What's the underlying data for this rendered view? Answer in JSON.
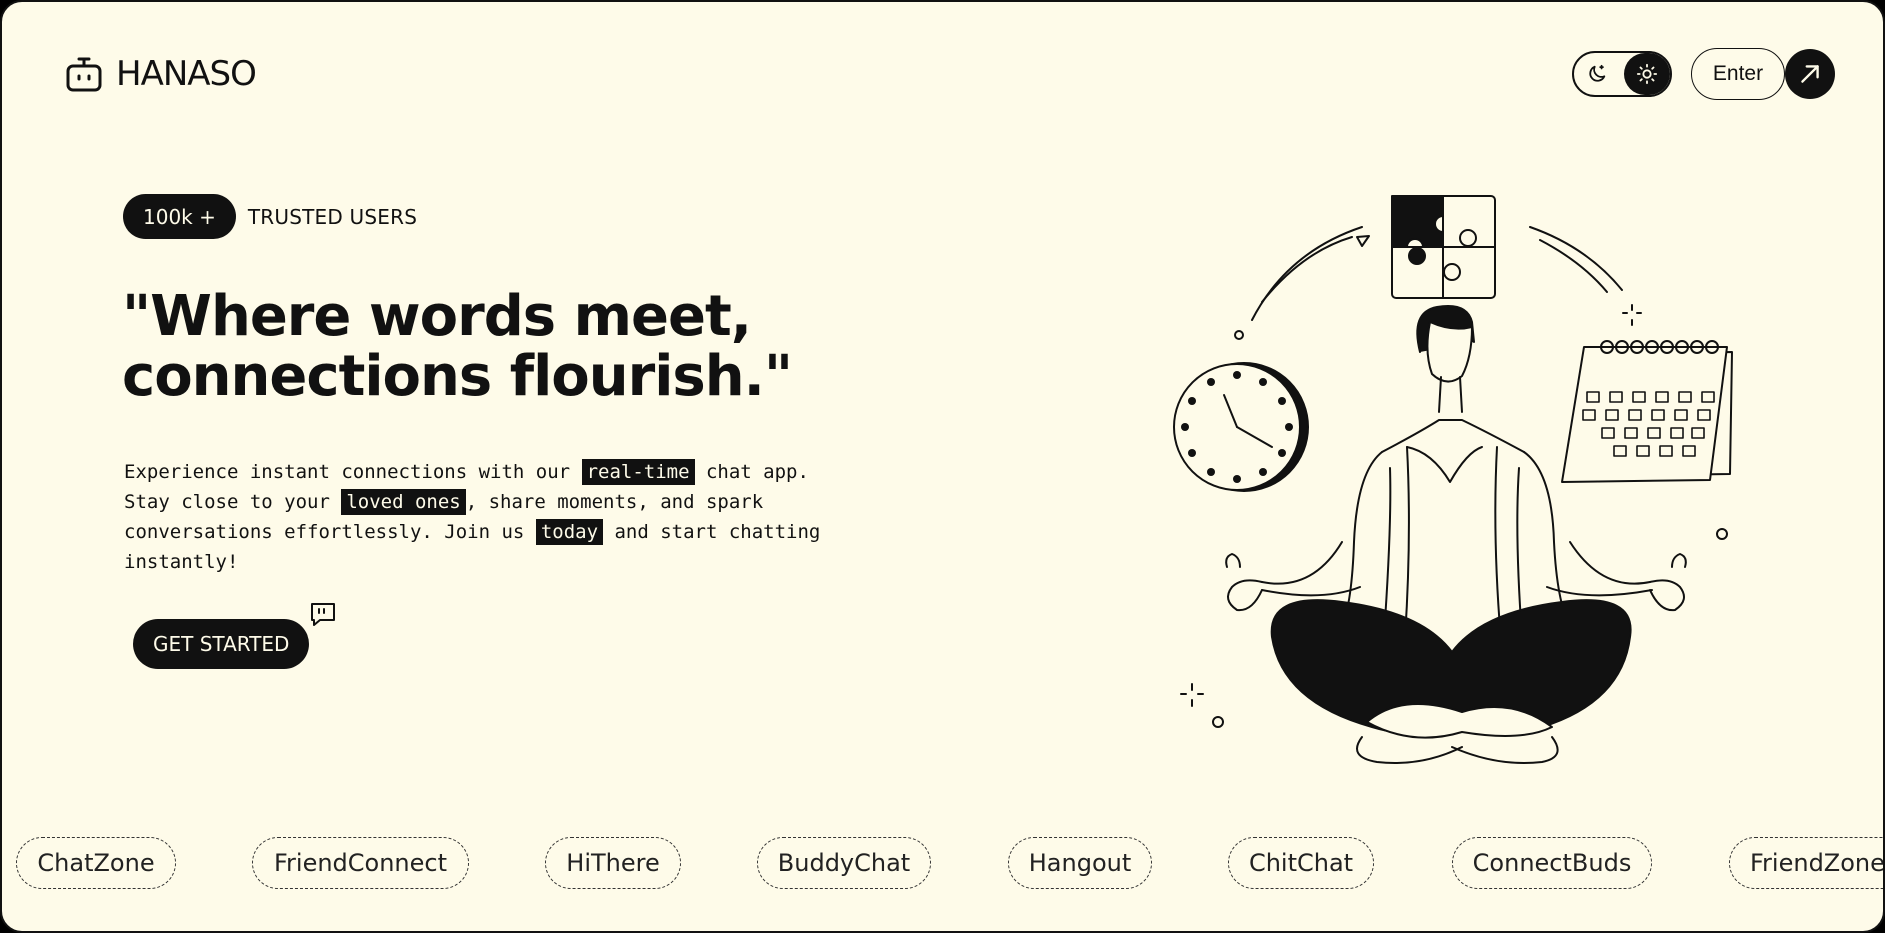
{
  "header": {
    "brand": "HANASO",
    "theme_toggle": {
      "dark_icon": "moon-icon",
      "light_icon": "sun-icon",
      "active": "light"
    },
    "enter_label": "Enter",
    "arrow_icon": "arrow-up-right-icon"
  },
  "hero": {
    "trusted_count": "100k +",
    "trusted_label": "TRUSTED USERS",
    "headline_line1": "\"Where words meet,",
    "headline_line2": "connections flourish.\"",
    "desc": {
      "p1": "Experience instant connections with our ",
      "h1": "real-time",
      "p2": " chat app. Stay close to your ",
      "h2": "loved ones",
      "p3": ", share moments, and spark conversations effortlessly. Join us ",
      "h3": "today",
      "p4": " and start chatting instantly!"
    },
    "cta_label": "GET STARTED",
    "cta_icon": "quote-bubble-icon"
  },
  "tags": [
    "ChatZone",
    "FriendConnect",
    "HiThere",
    "BuddyChat",
    "Hangout",
    "ChitChat",
    "ConnectBuds",
    "FriendZone"
  ],
  "colors": {
    "background": "#fefbe9",
    "ink": "#111111"
  }
}
